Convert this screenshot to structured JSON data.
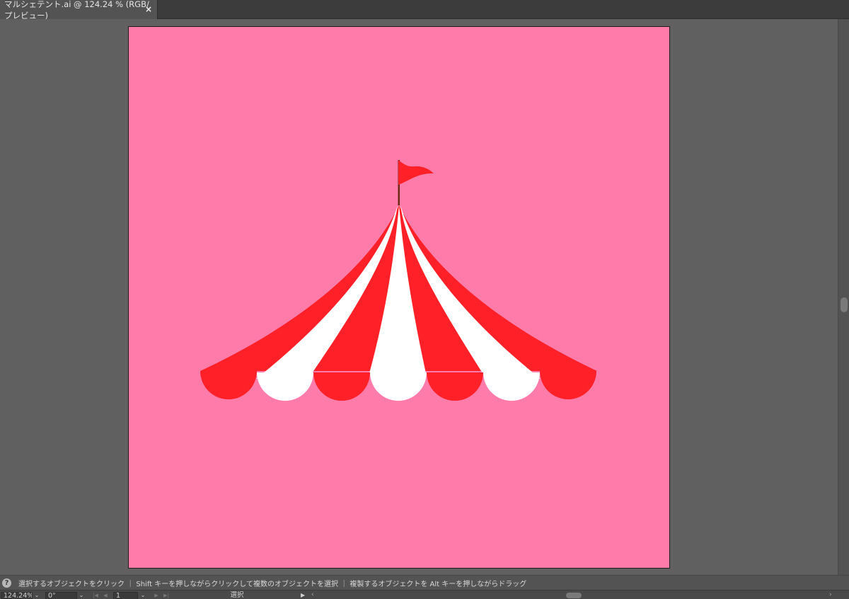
{
  "document_tab": {
    "title": "マルシェテント.ai @ 124.24 % (RGB/プレビュー)",
    "close_symbol": "×"
  },
  "artboard": {
    "background_color": "#ff7baa",
    "illustration": {
      "stripe_red": "#ff2127",
      "stripe_white": "#ffffff",
      "flag_color": "#ff2127",
      "pole_color": "#6b2a14"
    }
  },
  "status_bar": {
    "help_icon": "?",
    "hint": "選択するオブジェクトをクリック ｜ Shift キーを押しながらクリックして複数のオブジェクトを選択 ｜ 複製するオブジェクトを Alt キーを押しながらドラッグ"
  },
  "bottom_bar": {
    "zoom": "124.24%",
    "rotation": "0°",
    "artboard_number": "1",
    "current_tool": "選択"
  }
}
